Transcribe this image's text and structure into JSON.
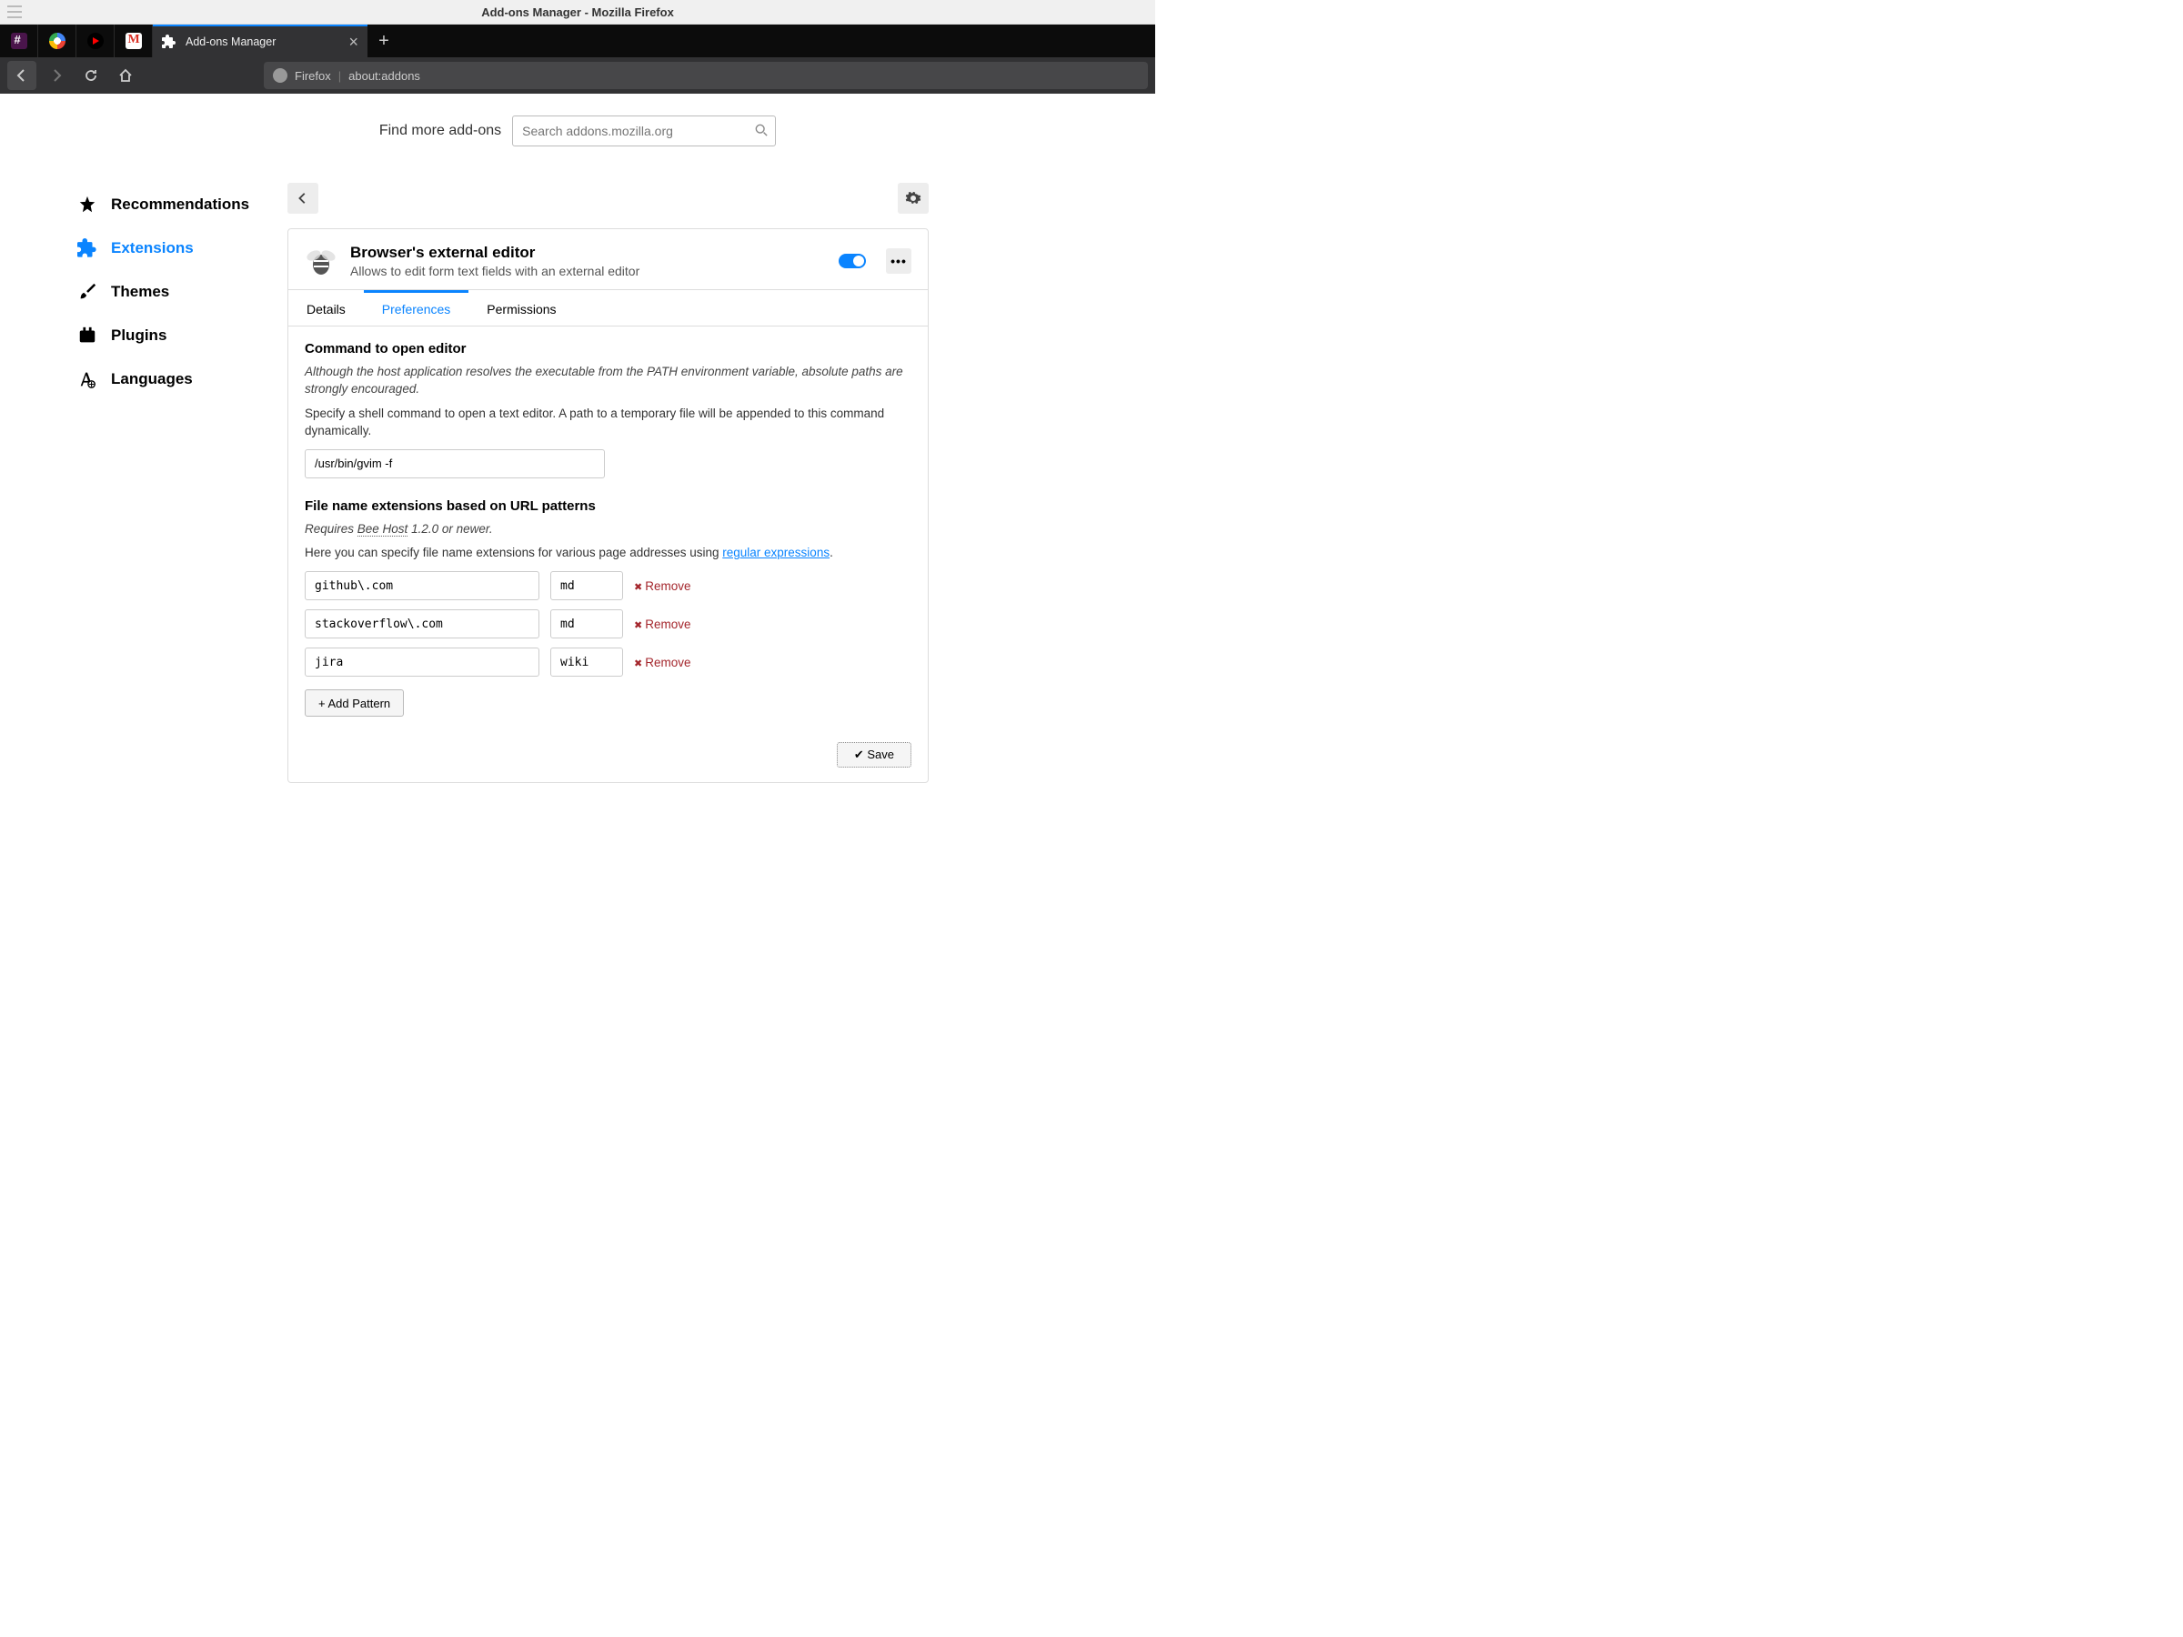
{
  "window_title": "Add-ons Manager - Mozilla Firefox",
  "tab": {
    "title": "Add-ons Manager"
  },
  "urlbar": {
    "identity": "Firefox",
    "url": "about:addons"
  },
  "search": {
    "label": "Find more add-ons",
    "placeholder": "Search addons.mozilla.org"
  },
  "sidebar": {
    "recommendations": "Recommendations",
    "extensions": "Extensions",
    "themes": "Themes",
    "plugins": "Plugins",
    "languages": "Languages"
  },
  "extension": {
    "name": "Browser's external editor",
    "description": "Allows to edit form text fields with an external editor"
  },
  "tabs": {
    "details": "Details",
    "preferences": "Preferences",
    "permissions": "Permissions"
  },
  "prefs": {
    "cmd_title": "Command to open editor",
    "cmd_note": "Although the host application resolves the executable from the PATH environment variable, absolute paths are strongly encouraged.",
    "cmd_help": "Specify a shell command to open a text editor. A path to a temporary file will be appended to this command dynamically.",
    "cmd_value": "/usr/bin/gvim -f",
    "patterns_title": "File name extensions based on URL patterns",
    "requires_prefix": "Requires ",
    "requires_link": "Bee Host",
    "requires_suffix": " 1.2.0 or newer.",
    "patterns_help_prefix": "Here you can specify file name extensions for various page addresses using ",
    "patterns_help_link": "regular expressions",
    "patterns_help_suffix": ".",
    "rows": [
      {
        "pattern": "github\\.com",
        "ext": "md"
      },
      {
        "pattern": "stackoverflow\\.com",
        "ext": "md"
      },
      {
        "pattern": "jira",
        "ext": "wiki"
      }
    ],
    "remove_label": "Remove",
    "add_label": "+ Add Pattern",
    "save_label": "✔ Save"
  }
}
